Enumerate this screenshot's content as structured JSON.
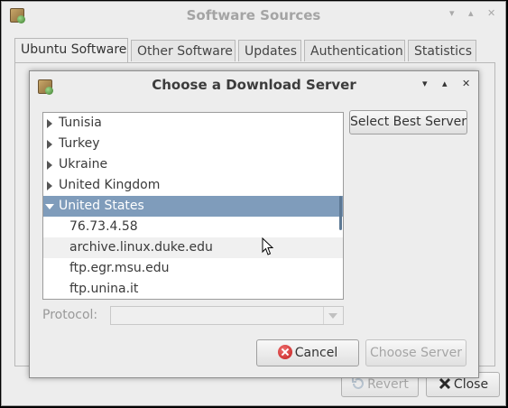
{
  "background_window": {
    "title": "Software Sources",
    "controls": [
      "▾",
      "▴",
      "✕"
    ],
    "tabs": [
      {
        "label": "Ubuntu Software",
        "active": true
      },
      {
        "label": "Other Software",
        "active": false
      },
      {
        "label": "Updates",
        "active": false
      },
      {
        "label": "Authentication",
        "active": false
      },
      {
        "label": "Statistics",
        "active": false
      }
    ],
    "revert_label": "Revert",
    "close_label": "Close"
  },
  "dialog": {
    "title": "Choose a Download Server",
    "controls": [
      "▾",
      "▴",
      "✕"
    ],
    "server_tree": [
      {
        "label": "Tunisia",
        "level": 0,
        "expanded": false
      },
      {
        "label": "Turkey",
        "level": 0,
        "expanded": false
      },
      {
        "label": "Ukraine",
        "level": 0,
        "expanded": false
      },
      {
        "label": "United Kingdom",
        "level": 0,
        "expanded": false
      },
      {
        "label": "United States",
        "level": 0,
        "expanded": true,
        "selected": true
      },
      {
        "label": "76.73.4.58",
        "level": 1
      },
      {
        "label": "archive.linux.duke.edu",
        "level": 1,
        "hover": true
      },
      {
        "label": "ftp.egr.msu.edu",
        "level": 1
      },
      {
        "label": "ftp.unina.it",
        "level": 1
      }
    ],
    "select_best_label": "Select Best Server",
    "protocol_label": "Protocol:",
    "protocol_value": "",
    "cancel_label": "Cancel",
    "choose_label": "Choose Server"
  },
  "colors": {
    "selection": "#7f9cbb",
    "cancel_icon": "#c21d1d"
  }
}
